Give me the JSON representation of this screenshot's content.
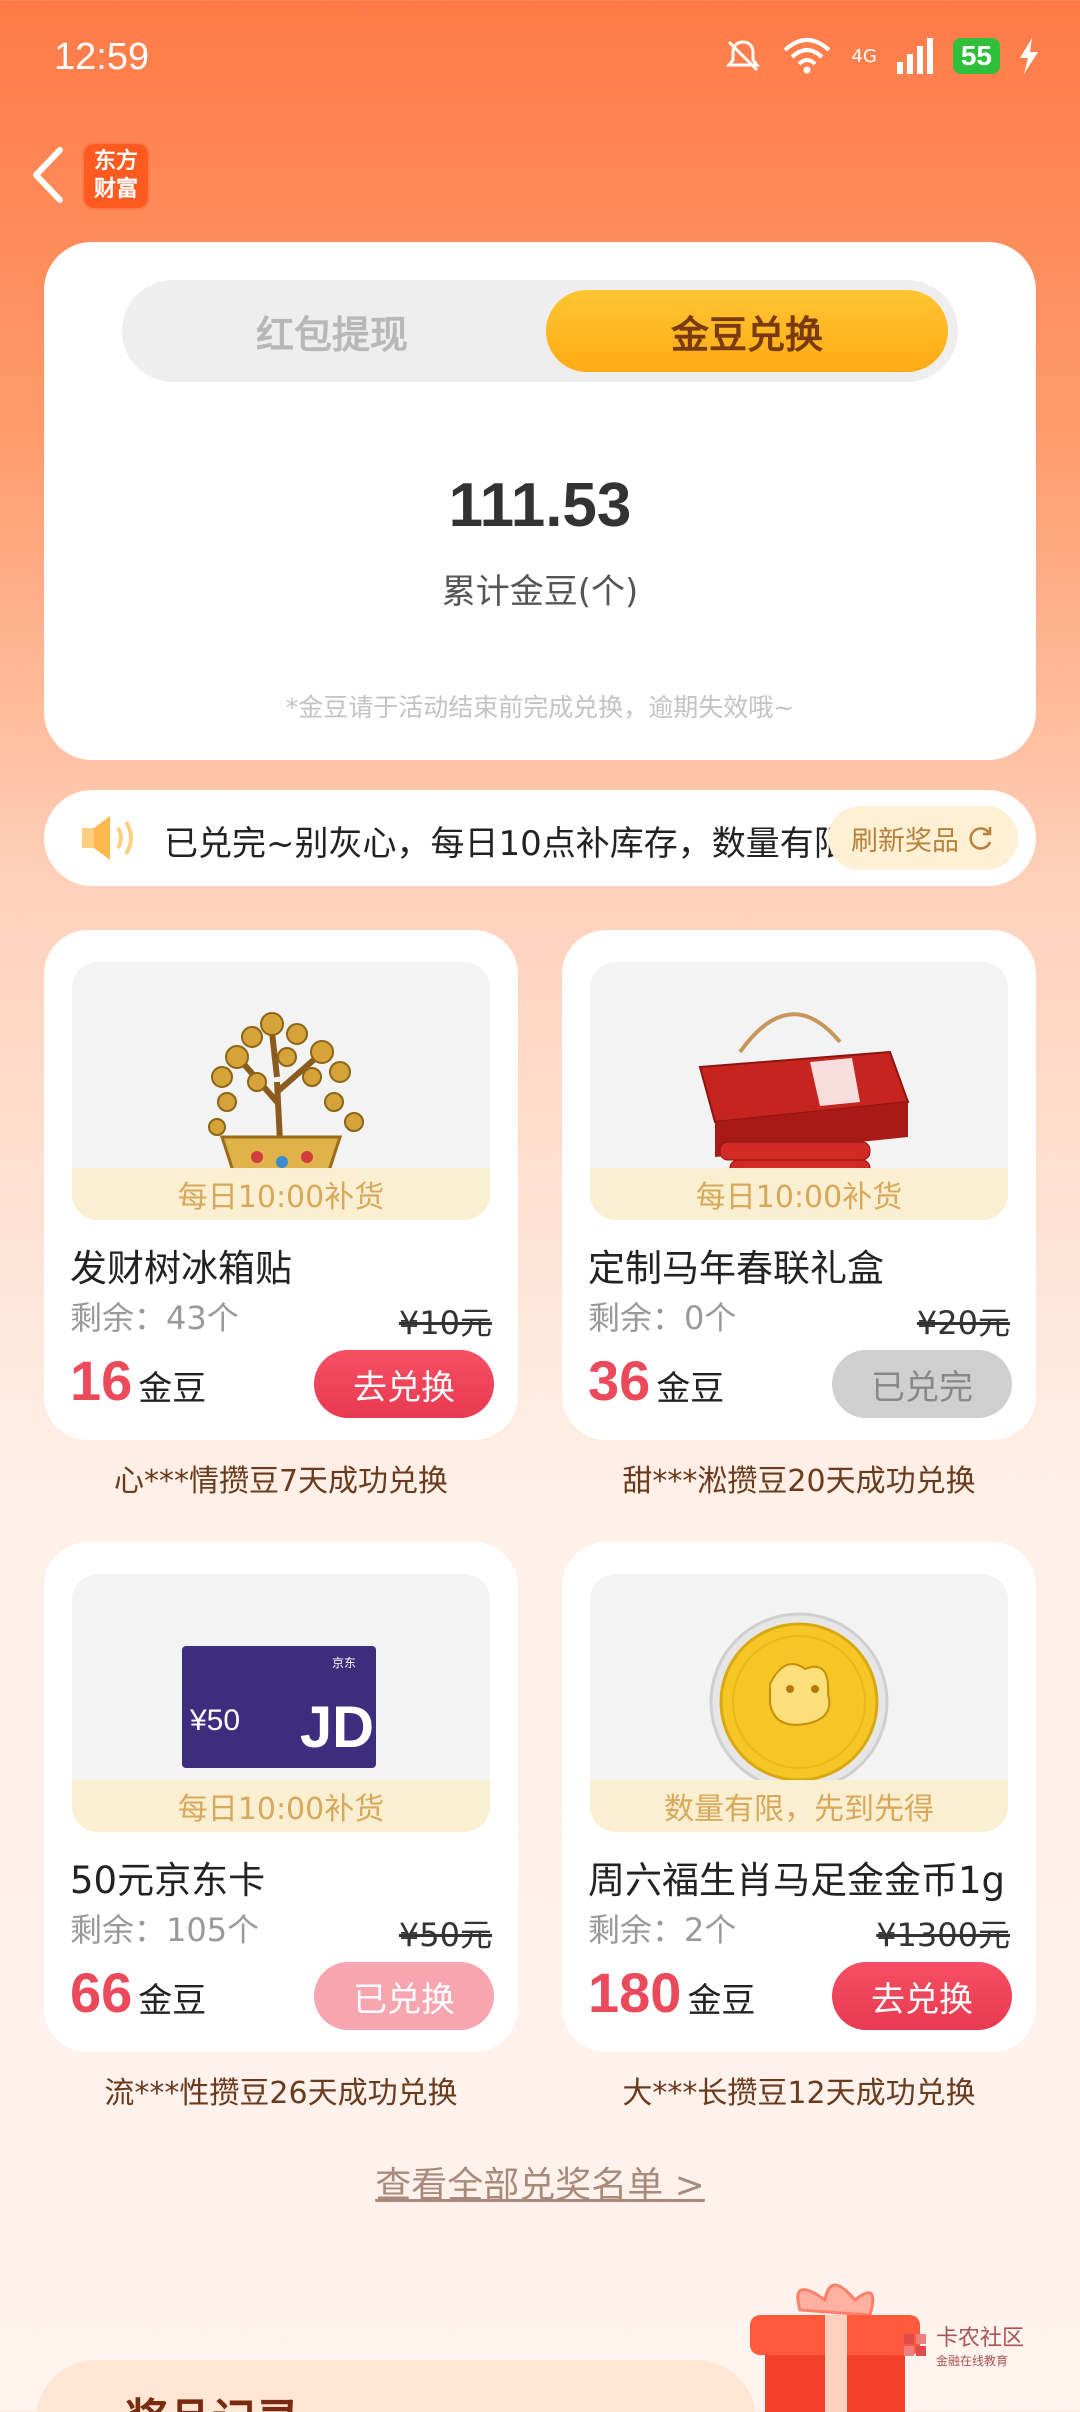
{
  "status": {
    "time": "12:59",
    "battery": "55",
    "network": "4G"
  },
  "header": {
    "logo_line1": "东方",
    "logo_line2": "财富"
  },
  "tabs": {
    "left": "红包提现",
    "right": "金豆兑换"
  },
  "summary": {
    "amount": "111.53",
    "label": "累计金豆(个)",
    "note": "*金豆请于活动结束前完成兑换，逾期失效哦~"
  },
  "notice": {
    "text": "已兑完~别灰心，每日10点补库存，数量有限",
    "refresh": "刷新奖品"
  },
  "products": [
    {
      "ribbon": "每日10:00补货",
      "title": "发财树冰箱贴",
      "stock": "剩余：43个",
      "original": "¥10元",
      "price": "16",
      "unit": "金豆",
      "button": "去兑换",
      "caption": "心***情攒豆7天成功兑换"
    },
    {
      "ribbon": "每日10:00补货",
      "title": "定制马年春联礼盒",
      "stock": "剩余：0个",
      "original": "¥20元",
      "price": "36",
      "unit": "金豆",
      "button": "已兑完",
      "caption": "甜***淞攒豆20天成功兑换"
    },
    {
      "ribbon": "每日10:00补货",
      "title": "50元京东卡",
      "stock": "剩余：105个",
      "original": "¥50元",
      "price": "66",
      "unit": "金豆",
      "button": "已兑换",
      "caption": "流***性攒豆26天成功兑换",
      "card_value": "¥50",
      "card_brand": "JD",
      "card_tag": "京东"
    },
    {
      "ribbon": "数量有限，先到先得",
      "title": "周六福生肖马足金金币1g",
      "stock": "剩余：2个",
      "original": "¥1300元",
      "price": "180",
      "unit": "金豆",
      "button": "去兑换",
      "caption": "大***长攒豆12天成功兑换"
    }
  ],
  "footer": {
    "view_all": "查看全部兑奖名单 >",
    "records_title": "奖品记录",
    "watermark": "卡农社区",
    "watermark_sub": "金融在线教育"
  }
}
